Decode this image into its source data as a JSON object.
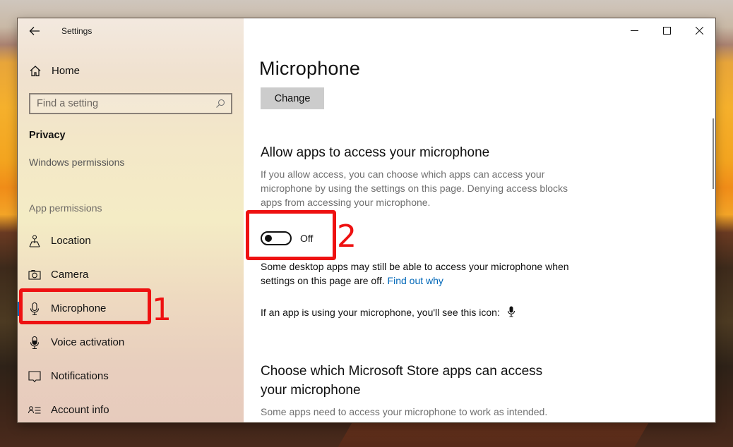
{
  "window": {
    "title": "Settings",
    "caption_buttons": [
      {
        "name": "minimize-icon"
      },
      {
        "name": "maximize-icon"
      },
      {
        "name": "close-icon"
      }
    ]
  },
  "sidebar": {
    "back_icon": "arrow-left-icon",
    "home": {
      "label": "Home",
      "icon": "home-icon"
    },
    "search": {
      "placeholder": "Find a setting",
      "value": "",
      "icon": "search-icon"
    },
    "section_title": "Privacy",
    "windows_permissions": "Windows permissions",
    "app_permissions_header": "App permissions",
    "items": [
      {
        "label": "Location",
        "icon": "location-icon",
        "selected": false
      },
      {
        "label": "Camera",
        "icon": "camera-icon",
        "selected": false
      },
      {
        "label": "Microphone",
        "icon": "microphone-icon",
        "selected": true
      },
      {
        "label": "Voice activation",
        "icon": "microphone-filled-icon",
        "selected": false
      },
      {
        "label": "Notifications",
        "icon": "speech-bubble-icon",
        "selected": false
      },
      {
        "label": "Account info",
        "icon": "account-info-icon",
        "selected": false
      }
    ],
    "accent_color": "#0063b1"
  },
  "main": {
    "page_title": "Microphone",
    "change_button": "Change",
    "allow_section": {
      "heading": "Allow apps to access your microphone",
      "description": "If you allow access, you can choose which apps can access your microphone by using the settings on this page. Denying access blocks apps from accessing your microphone.",
      "toggle": {
        "state": "Off",
        "on": false
      },
      "desktop_note": "Some desktop apps may still be able to access your microphone when settings on this page are off.",
      "find_out_link": "Find out why",
      "icon_note": "If an app is using your microphone, you'll see this icon:",
      "icon_note_icon": "microphone-filled-icon"
    },
    "store_section": {
      "heading": "Choose which Microsoft Store apps can access your microphone",
      "description": "Some apps need to access your microphone to work as intended."
    },
    "link_color": "#0067b8"
  },
  "annotations": [
    {
      "number": "1",
      "target": "Microphone sidebar item",
      "color": "#ee1111"
    },
    {
      "number": "2",
      "target": "Microphone access toggle",
      "color": "#ee1111"
    }
  ]
}
